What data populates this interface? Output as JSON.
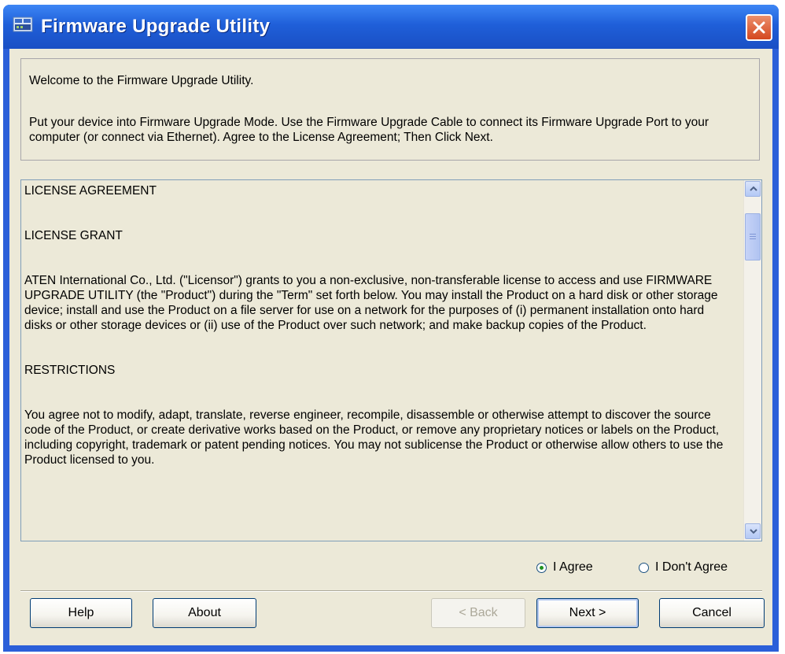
{
  "window": {
    "title": "Firmware Upgrade Utility"
  },
  "info": {
    "line1": "Welcome to the Firmware Upgrade Utility.",
    "line2": "Put your device into Firmware Upgrade Mode. Use the Firmware Upgrade Cable to connect its Firmware Upgrade Port to your computer (or connect via Ethernet). Agree to the License Agreement; Then Click Next."
  },
  "license": {
    "heading": "LICENSE AGREEMENT",
    "grant_heading": "LICENSE GRANT",
    "grant_text": "ATEN International Co., Ltd. (\"Licensor\") grants to you a non-exclusive, non-transferable license to access and use FIRMWARE UPGRADE UTILITY (the \"Product\") during the \"Term\" set forth below. You may install the Product on a hard disk or other storage device; install and use the Product on a file server for use on a network for the purposes of (i) permanent installation onto hard disks or other storage devices or (ii) use of the Product over such network; and make backup copies of the Product.",
    "restrictions_heading": "RESTRICTIONS",
    "restrictions_text": "You agree not to modify, adapt, translate, reverse engineer, recompile, disassemble or otherwise attempt to discover the source code of the Product, or create derivative works based on the Product, or remove any proprietary notices or labels on the Product, including copyright, trademark or patent pending notices. You may not sublicense the Product or otherwise allow others to use the Product licensed to you."
  },
  "agreement": {
    "agree_label": "I Agree",
    "disagree_label": "I Don't Agree",
    "selected": "agree"
  },
  "buttons": {
    "help": "Help",
    "about": "About",
    "back": "< Back",
    "next": "Next >",
    "cancel": "Cancel"
  }
}
